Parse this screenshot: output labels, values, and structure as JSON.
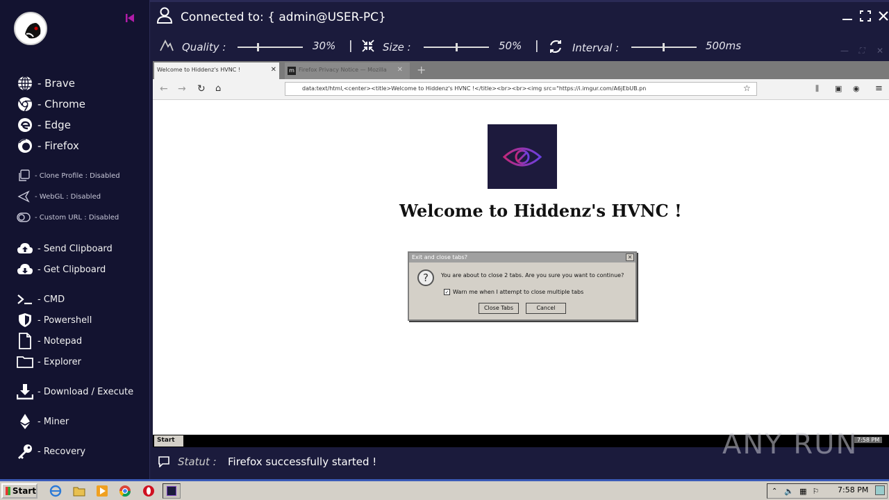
{
  "header": {
    "connection_text": "Connected to: { admin@USER-PC}"
  },
  "controls": {
    "quality_label": "Quality :",
    "quality_value": "30%",
    "size_label": "Size :",
    "size_value": "50%",
    "interval_label": "Interval :",
    "interval_value": "500ms",
    "separator": "|"
  },
  "sidebar": {
    "browsers": [
      {
        "label": "- Brave",
        "icon": "globe-icon"
      },
      {
        "label": "- Chrome",
        "icon": "chrome-icon"
      },
      {
        "label": "- Edge",
        "icon": "edge-icon"
      },
      {
        "label": "- Firefox",
        "icon": "firefox-icon"
      }
    ],
    "options": [
      {
        "label": "- Clone Profile : Disabled",
        "icon": "copy-icon"
      },
      {
        "label": "- WebGL : Disabled",
        "icon": "webgl-icon"
      },
      {
        "label": "- Custom URL : Disabled",
        "icon": "toggle-icon"
      }
    ],
    "clipboard": [
      {
        "label": "- Send Clipboard",
        "icon": "cloud-upload-icon"
      },
      {
        "label": "- Get Clipboard",
        "icon": "cloud-download-icon"
      }
    ],
    "tools": [
      {
        "label": "- CMD",
        "icon": "terminal-icon"
      },
      {
        "label": "- Powershell",
        "icon": "shield-icon"
      },
      {
        "label": "- Notepad",
        "icon": "file-icon"
      },
      {
        "label": "- Explorer",
        "icon": "folder-icon"
      }
    ],
    "download_execute": "- Download / Execute",
    "miner": "- Miner",
    "recovery": "- Recovery"
  },
  "remote": {
    "tab_active": "Welcome to Hiddenz's HVNC !",
    "tab_second": "Firefox Privacy Notice — Mozilla",
    "url": "data:text/html,<center><title>Welcome to Hiddenz's HVNC !</title><br><br><img src=\"https://i.imgur.com/A6jEbUB.pn",
    "welcome_heading": "Welcome to Hiddenz's HVNC !",
    "dialog_title": "Exit and close tabs?",
    "dialog_message": "You are about to close 2 tabs. Are you sure you want to continue?",
    "dialog_checkbox": "Warn me when I attempt to close multiple tabs",
    "dialog_close_btn": "Close Tabs",
    "dialog_cancel_btn": "Cancel",
    "remote_start": "Start",
    "remote_clock": "7:58 PM"
  },
  "status": {
    "label": "Statut :",
    "text": "Firefox successfully started !"
  },
  "watermark": "ANY RUN",
  "taskbar": {
    "start_label": "Start",
    "clock": "7:58 PM"
  },
  "colors": {
    "background": "#1c1c3a",
    "sidebar": "#131330",
    "accent": "#a0189a"
  }
}
